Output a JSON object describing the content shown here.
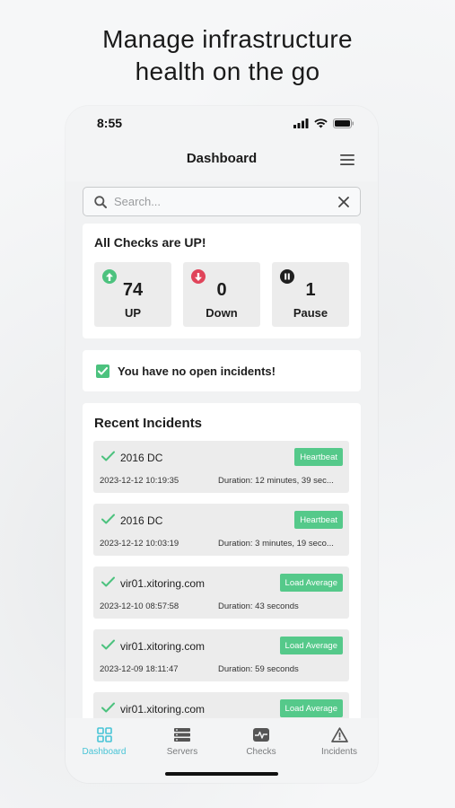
{
  "headline": {
    "line1": "Manage infrastructure",
    "line2": "health on the go"
  },
  "status_bar": {
    "time": "8:55",
    "icons": [
      "signal-icon",
      "wifi-icon",
      "battery-icon"
    ]
  },
  "nav": {
    "title": "Dashboard",
    "menu_icon": "hamburger-menu-icon"
  },
  "search": {
    "placeholder": "Search...",
    "value": ""
  },
  "checks": {
    "title": "All Checks are UP!",
    "stats": [
      {
        "label": "UP",
        "value": "74",
        "color": "#4cc27e",
        "icon": "arrow-up-icon"
      },
      {
        "label": "Down",
        "value": "0",
        "color": "#e0445a",
        "icon": "arrow-down-icon"
      },
      {
        "label": "Pause",
        "value": "1",
        "color": "#1f1f1f",
        "icon": "pause-icon"
      }
    ]
  },
  "open_incidents": {
    "text": "You have no open incidents!",
    "checked": true
  },
  "recent": {
    "title": "Recent Incidents",
    "items": [
      {
        "name": "2016 DC",
        "tag": "Heartbeat",
        "date": "2023-12-12 10:19:35",
        "duration": "Duration: 12 minutes, 39 sec..."
      },
      {
        "name": "2016 DC",
        "tag": "Heartbeat",
        "date": "2023-12-12 10:03:19",
        "duration": "Duration: 3 minutes, 19 seco..."
      },
      {
        "name": "vir01.xitoring.com",
        "tag": "Load Average",
        "date": "2023-12-10 08:57:58",
        "duration": "Duration: 43 seconds"
      },
      {
        "name": "vir01.xitoring.com",
        "tag": "Load Average",
        "date": "2023-12-09 18:11:47",
        "duration": "Duration: 59 seconds"
      },
      {
        "name": "vir01.xitoring.com",
        "tag": "Load Average",
        "date": "",
        "duration": ""
      }
    ]
  },
  "tabs": [
    {
      "label": "Dashboard",
      "icon": "dashboard-grid-icon",
      "active": true
    },
    {
      "label": "Servers",
      "icon": "servers-icon",
      "active": false
    },
    {
      "label": "Checks",
      "icon": "heartbeat-icon",
      "active": false
    },
    {
      "label": "Incidents",
      "icon": "warning-triangle-icon",
      "active": false
    }
  ],
  "colors": {
    "accent": "#47c4d6",
    "success": "#4cc27e",
    "tag": "#55c98a",
    "danger": "#e0445a"
  }
}
